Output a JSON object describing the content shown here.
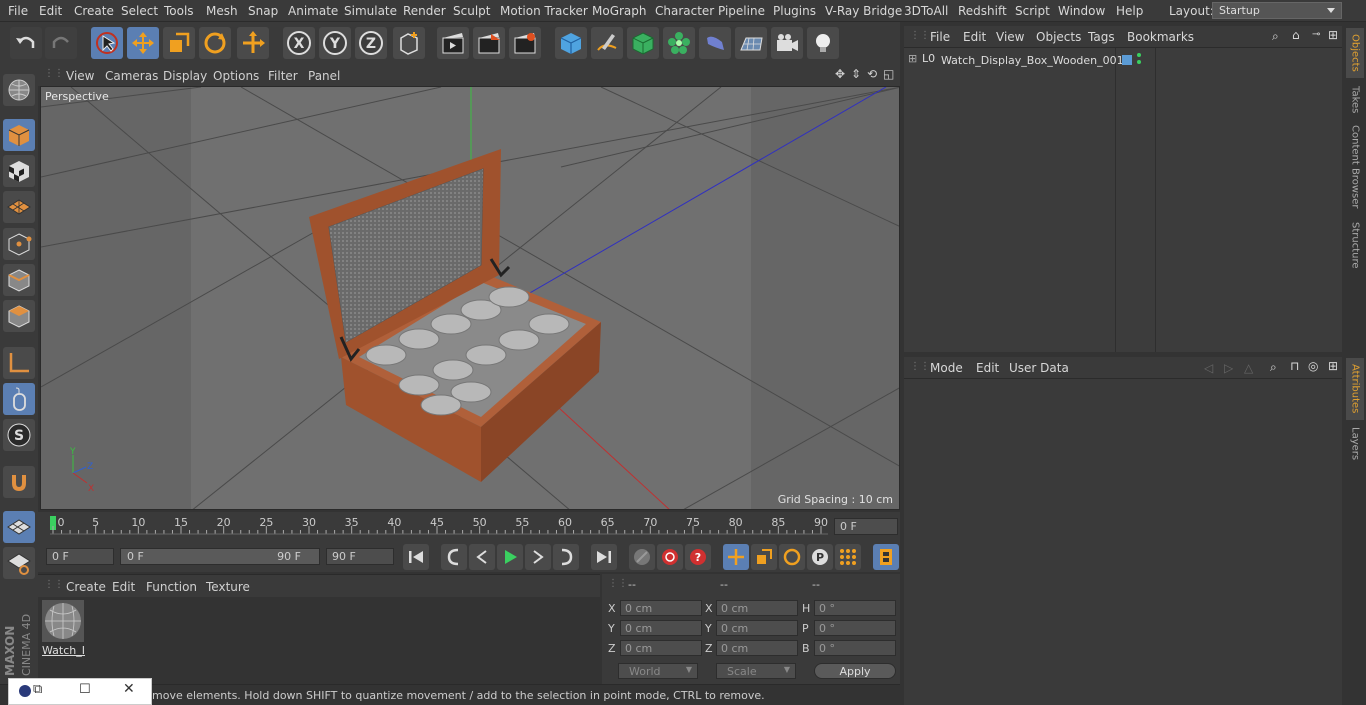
{
  "menu": [
    "File",
    "Edit",
    "Create",
    "Select",
    "Tools",
    "Mesh",
    "Snap",
    "Animate",
    "Simulate",
    "Render",
    "Sculpt",
    "Motion Tracker",
    "MoGraph",
    "Character",
    "Pipeline",
    "Plugins",
    "V-Ray Bridge",
    "3DToAll",
    "Redshift",
    "Script",
    "Window",
    "Help"
  ],
  "layout": {
    "label": "Layout:",
    "value": "Startup"
  },
  "viewport": {
    "menu": [
      "View",
      "Cameras",
      "Display",
      "Options",
      "Filter",
      "Panel"
    ],
    "label": "Perspective",
    "grid_spacing": "Grid Spacing : 10 cm"
  },
  "timeline": {
    "ticks": [
      "0",
      "5",
      "10",
      "15",
      "20",
      "25",
      "30",
      "35",
      "40",
      "45",
      "50",
      "55",
      "60",
      "65",
      "70",
      "75",
      "80",
      "85",
      "90"
    ],
    "current_frame": "0 F"
  },
  "playbar": {
    "start": "0 F",
    "range_start": "0 F",
    "range_end": "90 F",
    "end": "90 F"
  },
  "materials": {
    "menu": [
      "Create",
      "Edit",
      "Function",
      "Texture"
    ],
    "item": "Watch_I"
  },
  "coords": {
    "headers": [
      "--",
      "--",
      "--"
    ],
    "rows": [
      {
        "a": "X",
        "av": "0 cm",
        "b": "X",
        "bv": "0 cm",
        "c": "H",
        "cv": "0 °"
      },
      {
        "a": "Y",
        "av": "0 cm",
        "b": "Y",
        "bv": "0 cm",
        "c": "P",
        "cv": "0 °"
      },
      {
        "a": "Z",
        "av": "0 cm",
        "b": "Z",
        "bv": "0 cm",
        "c": "B",
        "cv": "0 °"
      }
    ],
    "mode": "World",
    "scale": "Scale",
    "apply": "Apply"
  },
  "objects": {
    "menu": [
      "File",
      "Edit",
      "View",
      "Objects",
      "Tags",
      "Bookmarks"
    ],
    "item": "Watch_Display_Box_Wooden_001"
  },
  "attributes": {
    "menu": [
      "Mode",
      "Edit",
      "User Data"
    ]
  },
  "right_tabs": [
    "Objects",
    "Takes",
    "Content Browser",
    "Structure",
    "Attributes",
    "Layers"
  ],
  "status": "move elements. Hold down SHIFT to quantize movement / add to the selection in point mode, CTRL to remove.",
  "brand": {
    "maxon": "MAXON",
    "product": "CINEMA 4D"
  },
  "colors": {
    "accent": "#5b7fb3",
    "bg": "#333333",
    "viewport": "#6b6b6b",
    "wood": "#a0522d"
  }
}
